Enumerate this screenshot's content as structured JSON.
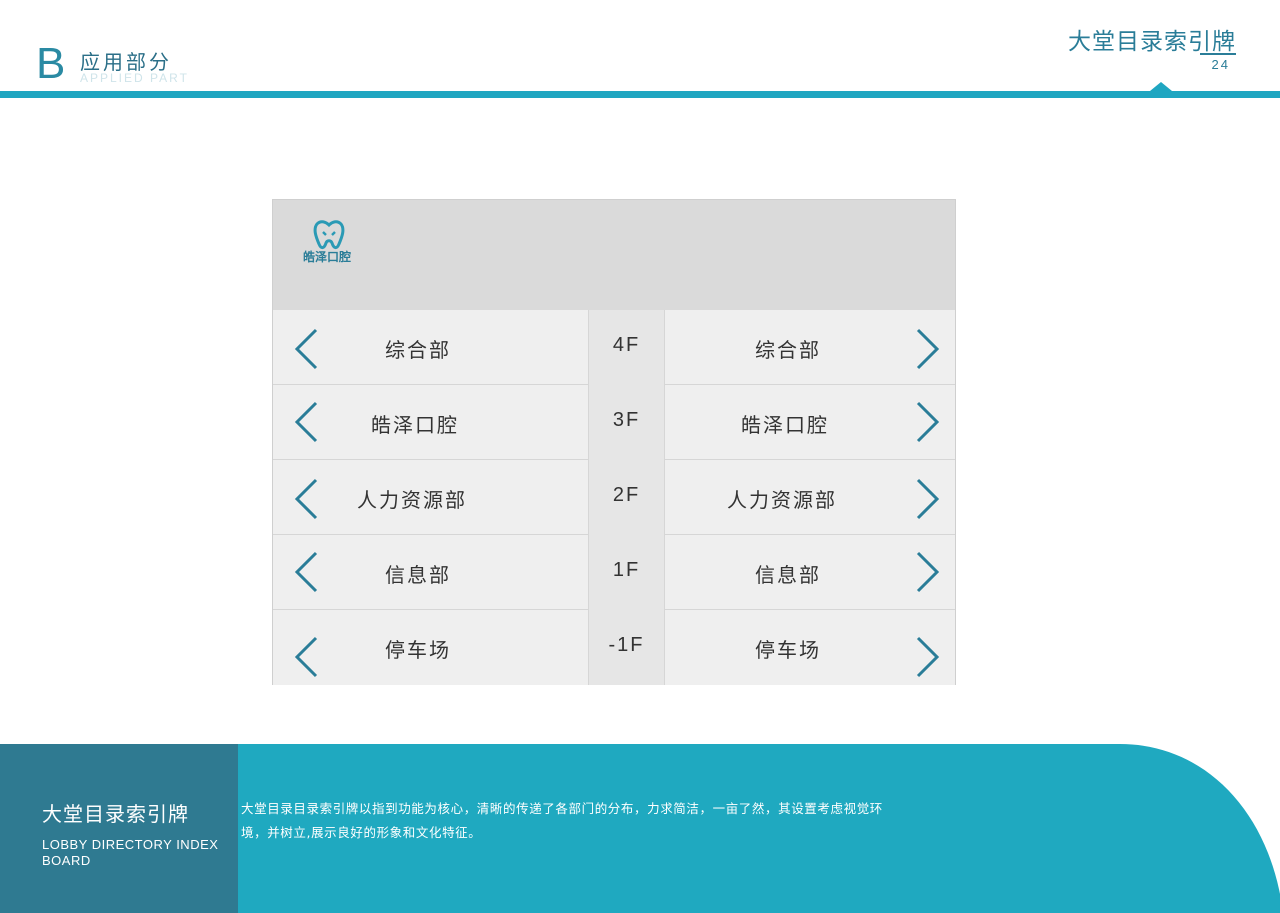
{
  "header": {
    "letter": "B",
    "section_cn": "应用部分",
    "section_en": "APPLIED PART",
    "page_title": "大堂目录索引牌",
    "page_number": "24"
  },
  "board": {
    "logo_text": "皓泽口腔",
    "rows": [
      {
        "left": "综合部",
        "floor": "4F",
        "right": "综合部"
      },
      {
        "left": "皓泽口腔",
        "floor": "3F",
        "right": "皓泽口腔"
      },
      {
        "left": "人力资源部",
        "floor": "2F",
        "right": "人力资源部"
      },
      {
        "left": "信息部",
        "floor": "1F",
        "right": "信息部"
      },
      {
        "left": "停车场",
        "floor": "-1F",
        "right": "停车场"
      }
    ]
  },
  "footer": {
    "title_cn": "大堂目录索引牌",
    "title_en": "LOBBY DIRECTORY INDEX BOARD",
    "description": "大堂目录目录索引牌以指到功能为核心，清晰的传递了各部门的分布，力求简洁，一亩了然，其设置考虑视觉环境，并树立,展示良好的形象和文化特征。"
  },
  "colors": {
    "accent": "#1fa6c1",
    "dark_teal": "#2f7a91",
    "text_teal": "#2a7d98"
  }
}
